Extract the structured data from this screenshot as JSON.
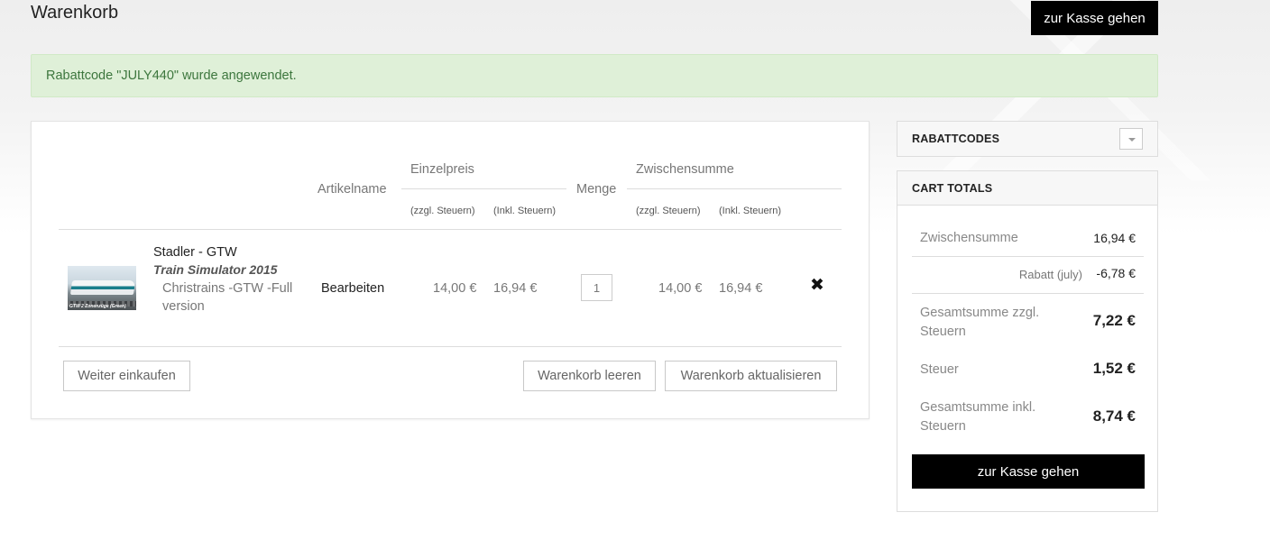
{
  "page": {
    "title": "Warenkorb",
    "checkout_label": "zur Kasse gehen"
  },
  "notice": {
    "message": "Rabattcode \"JULY440\" wurde angewendet."
  },
  "cart": {
    "headers": {
      "article_name": "Artikelname",
      "unit_price": "Einzelpreis",
      "quantity": "Menge",
      "subtotal": "Zwischensumme",
      "excl_tax": "(zzgl. Steuern)",
      "incl_tax": "(Inkl. Steuern)"
    },
    "items": [
      {
        "name": "Stadler - GTW",
        "series": "Train Simulator 2015",
        "variant": "Christrains -GTW -Full version",
        "thumbnail_caption": "GTW 2 Zonenzüge (Green)",
        "edit_label": "Bearbeiten",
        "unit_price_excl": "14,00 €",
        "unit_price_incl": "16,94 €",
        "quantity": "1",
        "subtotal_excl": "14,00 €",
        "subtotal_incl": "16,94 €",
        "remove_icon": "✖"
      }
    ],
    "buttons": {
      "continue_shopping": "Weiter einkaufen",
      "empty_cart": "Warenkorb leeren",
      "update_cart": "Warenkorb aktualisieren"
    }
  },
  "sidebar": {
    "coupons": {
      "title": "RABATTCODES",
      "toggle_icon": "chevron-down-icon"
    },
    "totals": {
      "title": "CART TOTALS",
      "subtotal_label": "Zwischensumme",
      "subtotal_value": "16,94 €",
      "discount_label": "Rabatt (july)",
      "discount_value": "-6,78 €",
      "total_excl_label": "Gesamtsumme zzgl. Steuern",
      "total_excl_value": "7,22 €",
      "tax_label": "Steuer",
      "tax_value": "1,52 €",
      "total_incl_label": "Gesamtsumme inkl. Steuern",
      "total_incl_value": "8,74 €",
      "checkout_label": "zur Kasse gehen"
    }
  },
  "colors": {
    "notice_bg": "#dff0d8",
    "notice_text": "#3c763d",
    "primary_button": "#000000"
  }
}
